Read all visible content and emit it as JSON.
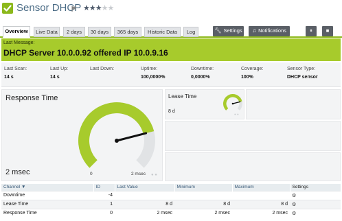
{
  "header": {
    "title": "Sensor DHCP",
    "priority_stars": 3,
    "priority_max": 5,
    "accent_color": "#8cb81b"
  },
  "tabs": [
    {
      "label": "Overview",
      "active": true
    },
    {
      "label": "Live Data"
    },
    {
      "label": "2 days"
    },
    {
      "label": "30 days"
    },
    {
      "label": "365 days"
    },
    {
      "label": "Historic Data"
    },
    {
      "label": "Log"
    }
  ],
  "actions": {
    "settings_label": "Settings",
    "settings_icon": "wrench-icon",
    "notifications_label": "Notifications",
    "notifications_icon": "bell-icon",
    "extra1_icon": "pause-icon",
    "extra2_icon": "delete-icon"
  },
  "last_message": {
    "label": "Last Message:",
    "text": "DHCP Server 10.0.0.92 offered IP 10.0.9.16",
    "color": "#a7cb2c"
  },
  "stats": [
    {
      "label": "Last Scan:",
      "value": "14 s"
    },
    {
      "label": "Last Up:",
      "value": "14 s"
    },
    {
      "label": "Last Down:",
      "value": ""
    },
    {
      "label": "Uptime:",
      "value": "100,0000%"
    },
    {
      "label": "Downtime:",
      "value": "0,0000%"
    },
    {
      "label": "Coverage:",
      "value": "100%"
    },
    {
      "label": "Sensor Type:",
      "value": "DHCP sensor"
    }
  ],
  "gauges": {
    "response_time": {
      "title": "Response Time",
      "value": "2 msec",
      "min_label": "0",
      "max_label": "2 msec",
      "level": 0.78
    },
    "lease_time": {
      "title": "Lease Time",
      "value": "8 d",
      "level": 0.78
    }
  },
  "table": {
    "headers": {
      "channel": "Channel",
      "id": "ID",
      "last_value": "Last Value",
      "minimum": "Minimum",
      "maximum": "Maximum",
      "settings": "Settings"
    },
    "rows": [
      {
        "channel": "Downtime",
        "id": "-4",
        "last_value": "",
        "minimum": "",
        "maximum": ""
      },
      {
        "channel": "Lease Time",
        "id": "1",
        "last_value": "8 d",
        "minimum": "8 d",
        "maximum": "8 d"
      },
      {
        "channel": "Response Time",
        "id": "0",
        "last_value": "2 msec",
        "minimum": "2 msec",
        "maximum": "2 msec"
      }
    ]
  }
}
